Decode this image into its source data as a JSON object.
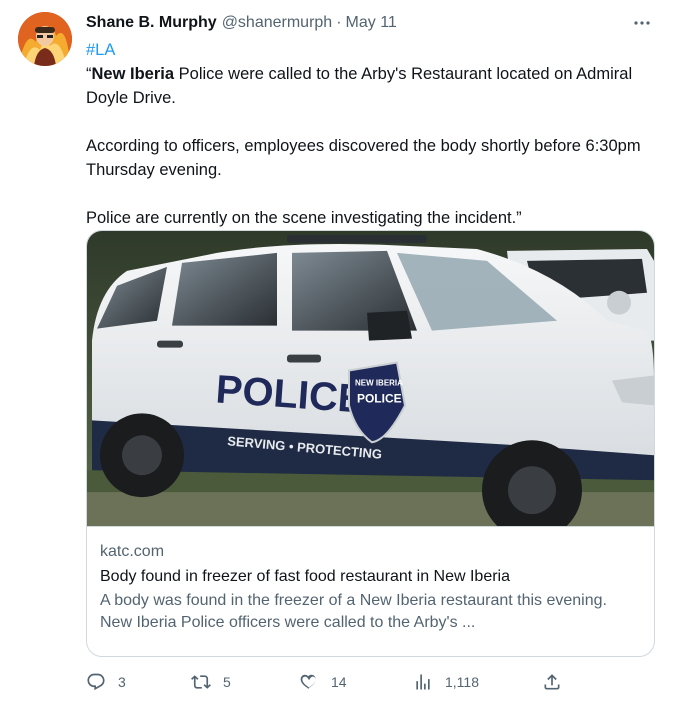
{
  "author": {
    "display_name": "Shane B. Murphy",
    "handle": "@shanermurph",
    "separator": "·",
    "date": "May 11"
  },
  "tweet": {
    "hashtag": "#LA",
    "line1_bold": "New Iberia",
    "line1_open_quote": "“",
    "line1_rest": " Police were called to the Arby's Restaurant located on Admiral Doyle Drive.",
    "para2": "According to officers, employees discovered the body shortly before 6:30pm Thursday evening.",
    "para3": "Police are currently on the scene investigating the incident.”"
  },
  "card": {
    "image_lettering": {
      "door": "POLICE",
      "badge_top": "NEW IBERIA",
      "badge_main": "POLICE",
      "stripe": "SERVING • PROTECTING"
    },
    "domain": "katc.com",
    "title": "Body found in freezer of fast food restaurant in New Iberia",
    "description": "A body was found in the freezer of a New Iberia restaurant this evening. New Iberia Police officers were called to the Arby's ..."
  },
  "actions": {
    "reply": {
      "icon": "reply-icon",
      "count": "3"
    },
    "retweet": {
      "icon": "retweet-icon",
      "count": "5"
    },
    "like": {
      "icon": "heart-icon",
      "count": "14"
    },
    "views": {
      "icon": "views-icon",
      "count": "1,118"
    },
    "share": {
      "icon": "share-icon"
    }
  },
  "colors": {
    "text": "#0f1419",
    "secondary": "#536471",
    "accent": "#1d9bf0",
    "border": "#cfd9de"
  }
}
